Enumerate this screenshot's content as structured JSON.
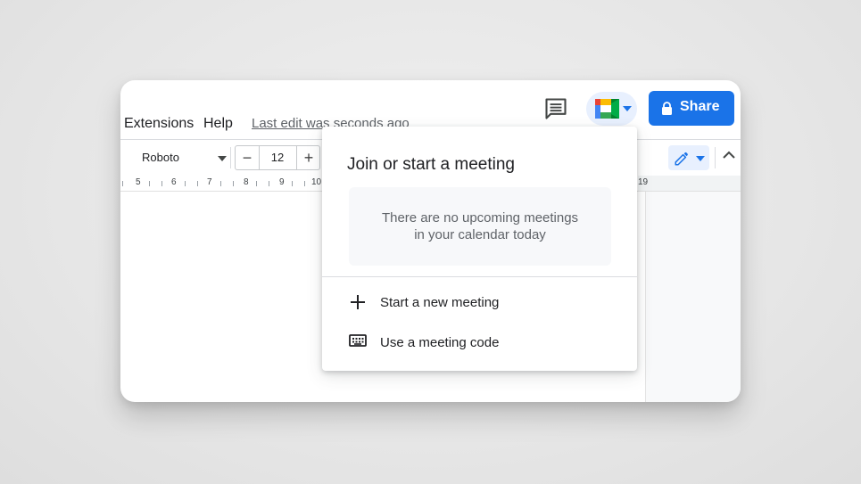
{
  "menu": {
    "extensions": "Extensions",
    "help": "Help",
    "last_edit": "Last edit was seconds ago"
  },
  "header": {
    "comment_icon": "comment-icon",
    "meet_icon": "google-meet-icon",
    "share_label": "Share",
    "share_icon": "lock-icon"
  },
  "toolbar": {
    "font_name": "Roboto",
    "font_size": "12",
    "minus": "−",
    "plus": "+",
    "edit_icon": "pencil-icon",
    "collapse_icon": "chevron-up-icon"
  },
  "ruler": {
    "numbers": [
      "5",
      "6",
      "7",
      "8",
      "9",
      "10",
      "19"
    ]
  },
  "popup": {
    "title": "Join or start a meeting",
    "empty_line1": "There are no upcoming meetings",
    "empty_line2": "in your calendar today",
    "items": [
      {
        "label": "Start a new meeting",
        "icon": "plus-icon"
      },
      {
        "label": "Use a meeting code",
        "icon": "keyboard-icon"
      }
    ]
  },
  "colors": {
    "accent": "#1a73e8",
    "meet_bg": "#e8f0fe",
    "text": "#202124",
    "muted": "#5f6368"
  }
}
